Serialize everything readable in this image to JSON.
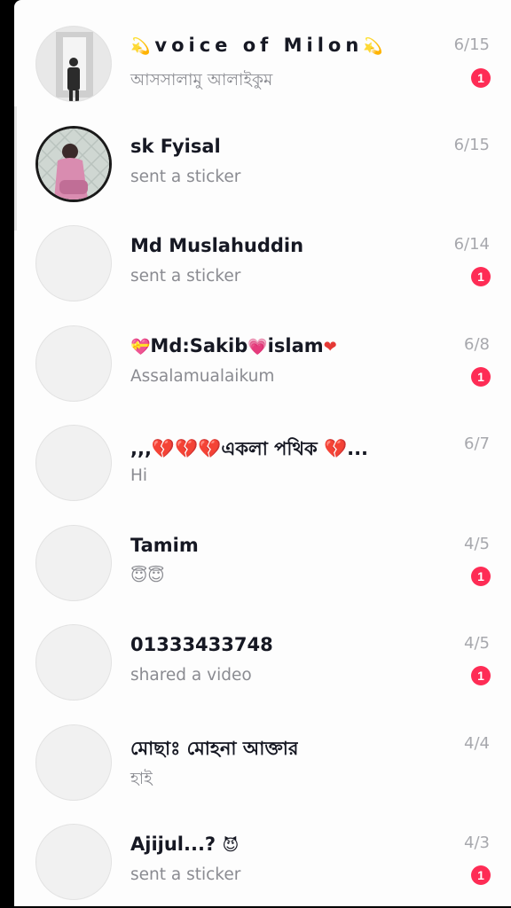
{
  "conversations": [
    {
      "name": "voice of Milon",
      "prefix_icon": "dizzy-emoji",
      "suffix_icon": "dizzy-emoji",
      "preview": "আসসালামু আলাইকুম",
      "date": "6/15",
      "unread": "1",
      "avatar": "photo-standing-man"
    },
    {
      "name": "sk Fyisal",
      "preview": "sent a sticker",
      "date": "6/15",
      "unread": "",
      "avatar": "photo-woman-pink"
    },
    {
      "name": "Md Muslahuddin",
      "preview": "sent a sticker",
      "date": "6/14",
      "unread": "1",
      "avatar": "blank"
    },
    {
      "name": "Md:Sakib",
      "name_tail": "islam",
      "prefix_icon": "heart-with-ribbon-emoji",
      "mid_icon": "sparkling-heart-emoji",
      "suffix_icon": "red-heart-emoji",
      "preview": "Assalamualaikum",
      "date": "6/8",
      "unread": "1",
      "avatar": "blank"
    },
    {
      "name": ",,,💔💔💔একলা পথিক 💔...",
      "preview": "Hi",
      "date": "6/7",
      "unread": "",
      "avatar": "blank"
    },
    {
      "name": "Tamim",
      "preview": "😇😇",
      "date": "4/5",
      "unread": "1",
      "avatar": "blank"
    },
    {
      "name": "01333433748",
      "preview": "shared a video",
      "date": "4/5",
      "unread": "1",
      "avatar": "blank"
    },
    {
      "name": "মোছাঃ মোহনা আক্তার",
      "preview": "হাই",
      "date": "4/4",
      "unread": "",
      "avatar": "blank"
    },
    {
      "name": "Ajijul...?",
      "suffix_icon": "smiling-devil-emoji",
      "preview": "sent a sticker",
      "date": "4/3",
      "unread": "1",
      "avatar": "blank"
    }
  ],
  "colors": {
    "badge": "#fe2c55",
    "name": "#161823",
    "preview": "#8a8b91",
    "date": "#a7a8ad"
  }
}
